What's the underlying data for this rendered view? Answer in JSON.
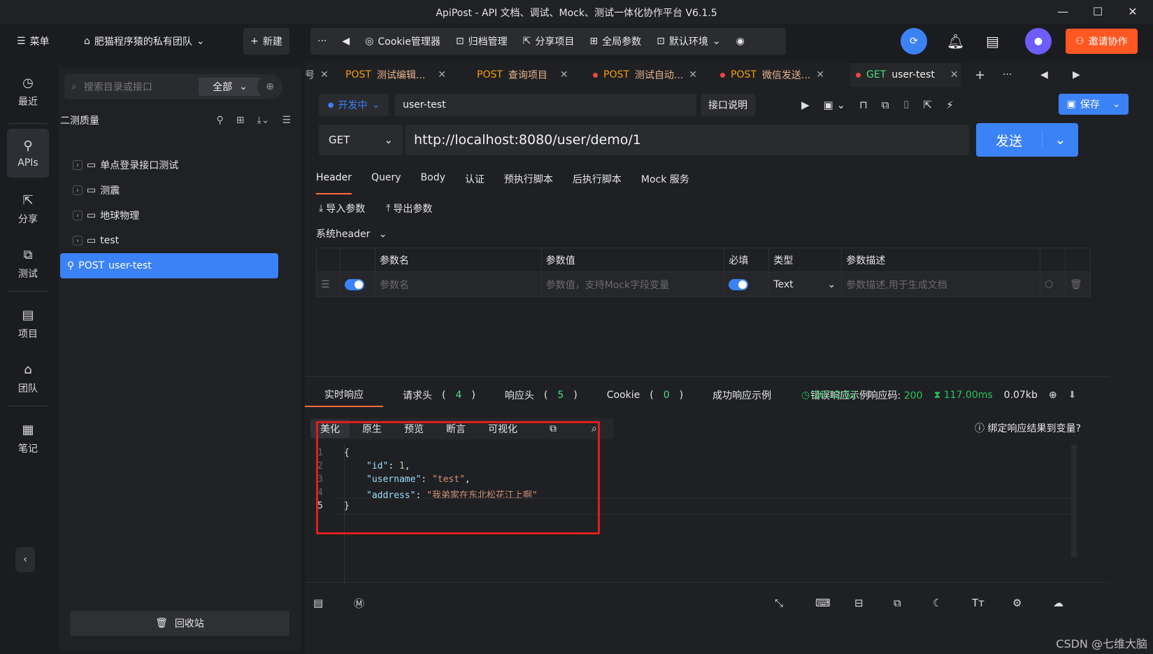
{
  "window": {
    "title": "ApiPost - API 文档、调试、Mock、测试一体化协作平台 V6.1.5"
  },
  "topbar": {
    "menu": "菜单",
    "team": "肥猫程序猿的私有团队",
    "new": "新建",
    "cookie": "Cookie管理器",
    "archive": "归档管理",
    "share_project": "分享项目",
    "global_params": "全局参数",
    "default_env": "默认环境",
    "invite": "邀请协作"
  },
  "rail": [
    {
      "label": "最近",
      "icon": "clock-icon"
    },
    {
      "label": "APIs",
      "icon": "api-icon"
    },
    {
      "label": "分享",
      "icon": "share-icon"
    },
    {
      "label": "测试",
      "icon": "test-icon"
    },
    {
      "label": "项目",
      "icon": "project-icon"
    },
    {
      "label": "团队",
      "icon": "team-icon"
    },
    {
      "label": "笔记",
      "icon": "note-icon"
    }
  ],
  "tree": {
    "search_placeholder": "搜索目录或接口",
    "filter": "全部",
    "project": "二测质量",
    "items": [
      {
        "label": "单点登录接口测试",
        "type": "folder"
      },
      {
        "label": "测震",
        "type": "folder"
      },
      {
        "label": "地球物理",
        "type": "folder"
      },
      {
        "label": "test",
        "type": "folder"
      }
    ],
    "active_item": {
      "method": "POST",
      "label": "user-test"
    },
    "trash": "回收站"
  },
  "tabs": [
    {
      "method": "POST",
      "label": "测试编辑...",
      "dot": false
    },
    {
      "method": "POST",
      "label": "查询项目",
      "dot": false
    },
    {
      "method": "POST",
      "label": "测试自动...",
      "dot": true
    },
    {
      "method": "POST",
      "label": "微信发送...",
      "dot": true
    },
    {
      "method": "GET",
      "label": "user-test",
      "dot": true
    }
  ],
  "tab_partial": "号",
  "request": {
    "env": "开发中",
    "name": "user-test",
    "doc_button": "接口说明",
    "save": "保存",
    "method": "GET",
    "url": "http://localhost:8080/user/demo/1",
    "send": "发送"
  },
  "req_tabs": [
    "Header",
    "Query",
    "Body",
    "认证",
    "预执行脚本",
    "后执行脚本",
    "Mock 服务"
  ],
  "import_params": "导入参数",
  "export_params": "导出参数",
  "system_header": "系统header",
  "params_table": {
    "headers": [
      "参数名",
      "参数值",
      "必填",
      "类型",
      "参数描述"
    ],
    "row": {
      "name_placeholder": "参数名",
      "value_placeholder": "参数值，支持Mock字段变量",
      "type": "Text",
      "desc_placeholder": "参数描述,用于生成文档"
    }
  },
  "response": {
    "tabs": {
      "realtime": "实时响应",
      "req_headers": "请求头",
      "req_headers_count": "4",
      "resp_headers": "响应头",
      "resp_headers_count": "5",
      "cookie": "Cookie",
      "cookie_count": "0",
      "success_example": "成功响应示例",
      "error_example": "错误响应示例"
    },
    "time": "16:12:52",
    "code_label": "响应码:",
    "code": "200",
    "duration": "117.00ms",
    "size": "0.07kb",
    "view_tabs": [
      "美化",
      "原生",
      "预览",
      "断言",
      "可视化"
    ],
    "bind_var": "绑定响应结果到变量?",
    "code_lines": [
      {
        "ln": "1",
        "text": "{"
      },
      {
        "ln": "2",
        "key": "\"id\"",
        "val": "1",
        "comma": ","
      },
      {
        "ln": "3",
        "key": "\"username\"",
        "val": "\"test\"",
        "comma": ","
      },
      {
        "ln": "4",
        "key": "\"address\"",
        "val": "\"我弟家在东北松花江上啊\"",
        "comma": ""
      },
      {
        "ln": "5",
        "text": "}"
      }
    ]
  },
  "watermark": "CSDN @七维大脑"
}
